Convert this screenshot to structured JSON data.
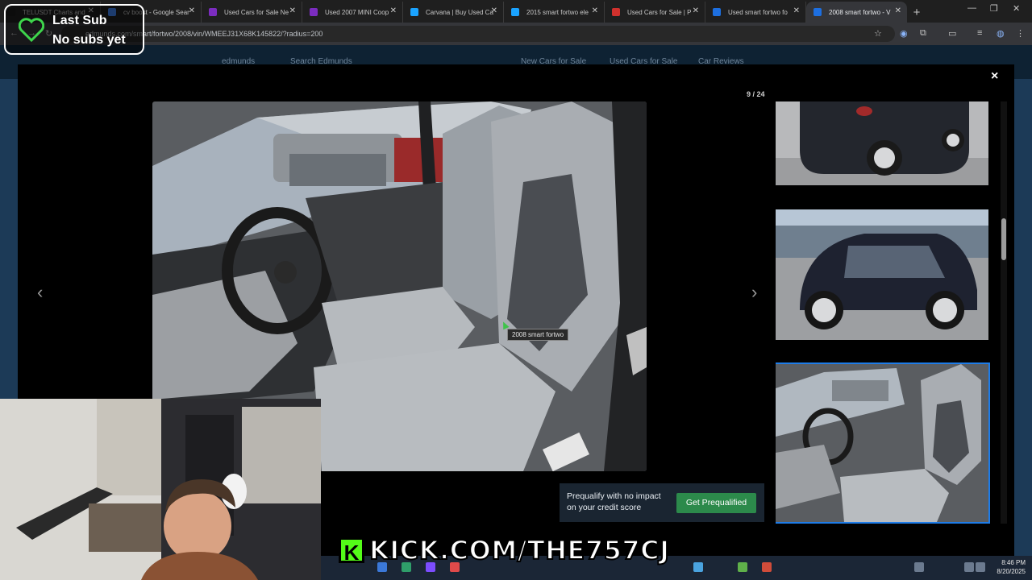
{
  "browser": {
    "tabs": [
      {
        "label": "TELUSDT Charts and",
        "favicon_color": "#1b1b1b",
        "active": false
      },
      {
        "label": "cv boost - Google Sear",
        "favicon_color": "#4285f4",
        "active": false
      },
      {
        "label": "Used Cars for Sale Ne",
        "favicon_color": "#7b2cbf",
        "active": false
      },
      {
        "label": "Used 2007 MINI Coop",
        "favicon_color": "#7b2cbf",
        "active": false
      },
      {
        "label": "Carvana | Buy Used Ca",
        "favicon_color": "#1aa3ff",
        "active": false
      },
      {
        "label": "2015 smart fortwo ele",
        "favicon_color": "#1aa3ff",
        "active": false
      },
      {
        "label": "Used Cars for Sale | P",
        "favicon_color": "#d0312d",
        "active": false
      },
      {
        "label": "Used smart fortwo fo",
        "favicon_color": "#1d6fe0",
        "active": false
      },
      {
        "label": "2008 smart fortwo - V",
        "favicon_color": "#1d6fe0",
        "active": true
      }
    ],
    "new_tab_label": "+",
    "url": "edmunds.com/smart/fortwo/2008/vin/WMEEJ31X68K145822/?radius=200"
  },
  "background_page": {
    "nav_items": [
      "edmunds",
      "Search Edmunds",
      "New Cars for Sale",
      "Used Cars for Sale",
      "Car Reviews"
    ]
  },
  "gallery": {
    "counter": "9 / 24",
    "close_label": "×",
    "prev_label": "‹",
    "next_label": "›",
    "tooltip": "2008 smart fortwo",
    "main_image_alt": "2008 smart fortwo interior",
    "thumbnails": [
      {
        "name": "rear-view"
      },
      {
        "name": "side-view"
      },
      {
        "name": "interior-view",
        "selected": true
      }
    ]
  },
  "prequal": {
    "text": "Prequalify with no impact on your credit score",
    "button_label": "Get Prequalified"
  },
  "overlay": {
    "sub_line1": "Last Sub",
    "sub_line2": "No subs yet",
    "kick_logo": "K",
    "kick_url": "KICK.COM/THE757CJ"
  },
  "taskbar": {
    "time": "8:46 PM",
    "date": "8/20/2025"
  },
  "colors": {
    "accent_blue": "#1e7ce8",
    "prequal_green": "#2c8a4b",
    "kick_green": "#53fc18"
  }
}
